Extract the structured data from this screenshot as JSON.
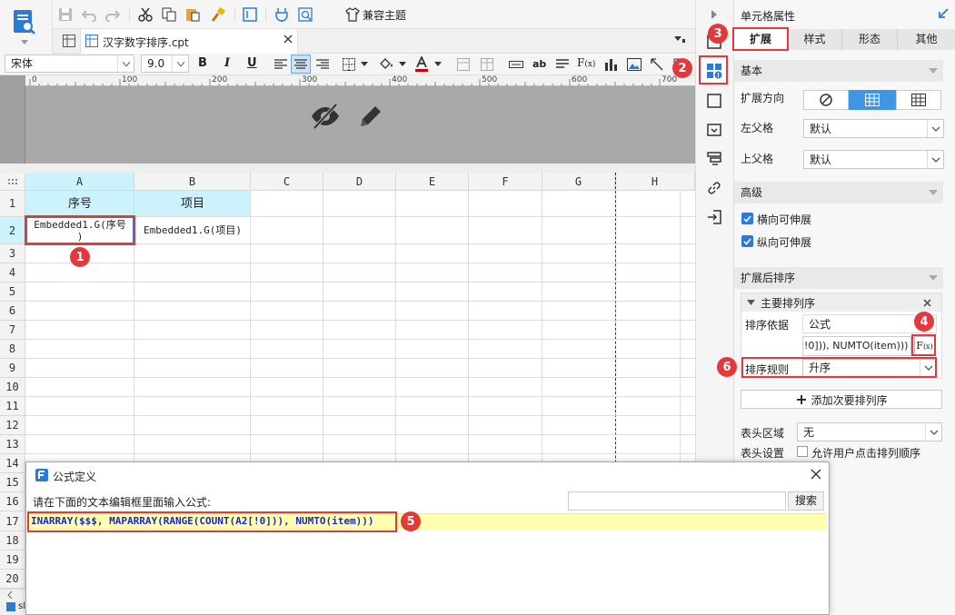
{
  "app": {
    "theme_label": "兼容主题"
  },
  "file_tab": {
    "name": "汉字数字排序.cpt"
  },
  "format_toolbar": {
    "font": "宋体",
    "size": "9.0",
    "bold": "B",
    "italic": "I",
    "underline": "U",
    "text_abbr": "ab"
  },
  "ruler": {
    "ticks": [
      "0",
      "100",
      "200",
      "300",
      "400",
      "500",
      "600",
      "700"
    ]
  },
  "grid": {
    "columns": [
      "A",
      "B",
      "C",
      "D",
      "E",
      "F",
      "G",
      "H"
    ],
    "rows": [
      "1",
      "2",
      "3",
      "4",
      "5",
      "6",
      "7",
      "8",
      "9",
      "10",
      "11",
      "12",
      "13",
      "14",
      "15",
      "16",
      "17",
      "18",
      "19",
      "20"
    ],
    "a1": "序号",
    "b1": "项目",
    "a2_line1": "Embedded1.G(序号",
    "a2_line2": ")",
    "b2": "Embedded1.G(项目)"
  },
  "sheet_tab": "sl",
  "side_panel": {
    "title": "单元格属性",
    "tabs": [
      "扩展",
      "样式",
      "形态",
      "其他"
    ],
    "basic": {
      "title": "基本",
      "direction_label": "扩展方向",
      "left_parent_label": "左父格",
      "left_parent_value": "默认",
      "top_parent_label": "上父格",
      "top_parent_value": "默认"
    },
    "advanced": {
      "title": "高级",
      "horizontal": "横向可伸展",
      "vertical": "纵向可伸展"
    },
    "sort": {
      "title": "扩展后排序",
      "main_title": "主要排列序",
      "basis_label": "排序依据",
      "basis_value": "公式",
      "formula_value": "!0])), NUMTO(item)))",
      "rule_label": "排序规则",
      "rule_value": "升序",
      "add_secondary": "添加次要排列序",
      "header_area_label": "表头区域",
      "header_area_value": "无",
      "header_setting_label": "表头设置",
      "header_setting_value": "允许用户点击排列顺序"
    }
  },
  "dialog": {
    "title": "公式定义",
    "prompt": "请在下面的文本编辑框里面输入公式:",
    "search_placeholder": "",
    "search_button": "搜索",
    "formula": "INARRAY($$$, MAPARRAY(RANGE(COUNT(A2[!0])), NUMTO(item)))"
  },
  "badges": [
    "1",
    "2",
    "3",
    "4",
    "5",
    "6"
  ],
  "colors": {
    "accent": "#2b7bd6",
    "header_cell": "#ccf2fb",
    "highlight": "#ffffb0",
    "red": "#e4393c"
  }
}
